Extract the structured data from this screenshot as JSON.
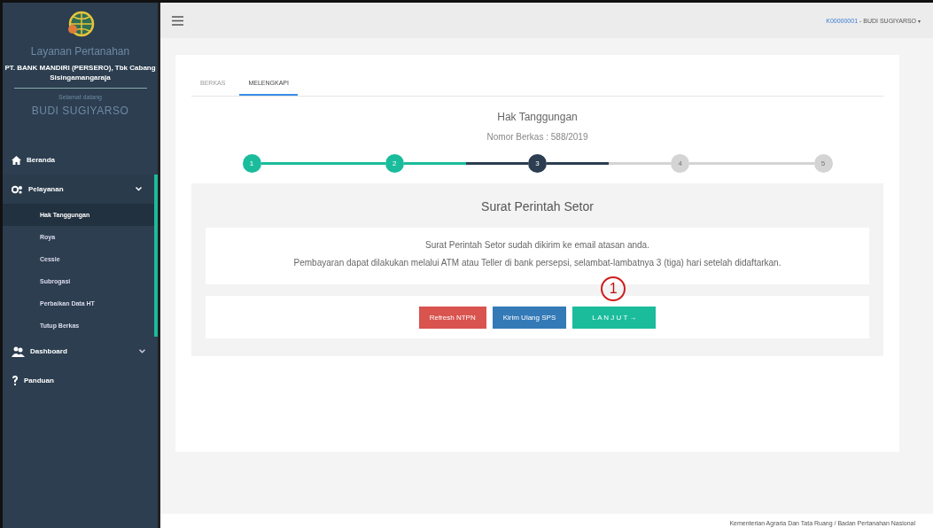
{
  "sidebar": {
    "app_name": "Layanan Pertanahan",
    "org": "PT. BANK MANDIRI (PERSERO), Tbk Cabang Sisingamangaraja",
    "greeting": "Selamat datang",
    "user": "BUDI SUGIYARSO",
    "items": [
      {
        "label": "Beranda",
        "kind": "home"
      },
      {
        "label": "Pelayanan",
        "kind": "services",
        "expanded": true,
        "children": [
          {
            "label": "Hak Tanggungan",
            "selected": true
          },
          {
            "label": "Roya",
            "selected": false
          },
          {
            "label": "Cessie",
            "selected": false
          },
          {
            "label": "Subrogasi",
            "selected": false
          },
          {
            "label": "Perbaikan Data HT",
            "selected": false
          },
          {
            "label": "Tutup Berkas",
            "selected": false
          }
        ]
      },
      {
        "label": "Dashboard",
        "kind": "dashboard",
        "expanded": false
      },
      {
        "label": "Panduan",
        "kind": "help"
      }
    ]
  },
  "topbar": {
    "user_code": "K00000001",
    "user_name": " - BUDI SUGIYARSO",
    "caret": "▾"
  },
  "tabs": [
    {
      "label": "BERKAS",
      "selected": false
    },
    {
      "label": "MELENGKAPI",
      "selected": true
    }
  ],
  "title": "Hak Tanggungan",
  "file_number": "Nomor Berkas : 588/2019",
  "steps": [
    {
      "label": "1",
      "completed": true,
      "selected": false
    },
    {
      "label": "2",
      "completed": true,
      "selected": false
    },
    {
      "label": "3",
      "completed": false,
      "selected": true
    },
    {
      "label": "4",
      "completed": false,
      "selected": false
    },
    {
      "label": "5",
      "completed": false,
      "selected": false
    }
  ],
  "panel": {
    "heading": "Surat Perintah Setor",
    "messages": [
      "Surat Perintah Setor sudah dikirim ke email atasan anda.",
      "Pembayaran dapat dilakukan melalui ATM atau Teller di bank persepsi, selambat-lambatnya 3 (tiga) hari setelah didaftarkan."
    ],
    "buttons": [
      {
        "label": "Refresh NTPN",
        "kind": "danger"
      },
      {
        "label": "Kirim Ulang SPS",
        "kind": "primary"
      },
      {
        "label": "L A N J U T →",
        "kind": "success",
        "annotation": "1"
      }
    ]
  },
  "footer": "Kementerian Agraria Dan Tata Ruang / Badan Pertanahan Nasional"
}
